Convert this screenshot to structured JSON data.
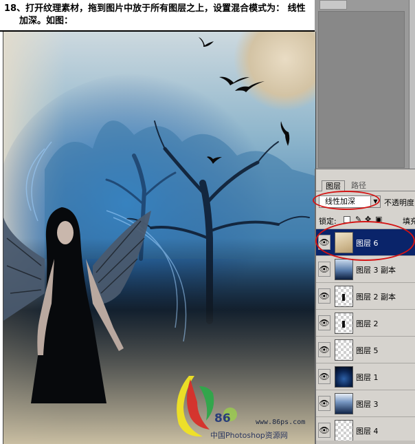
{
  "caption": {
    "line1": "18、打开纹理素材，拖到图片中放于所有图层之上，设置混合模式为： 线性",
    "line2": "加深。如图："
  },
  "palette": {
    "tabs": [
      {
        "label": "图层",
        "active": true
      },
      {
        "label": "路径",
        "active": false
      }
    ],
    "blend_mode": "线性加深",
    "opacity_label": "不透明度",
    "lock_label": "锁定:",
    "fill_label": "填充",
    "layers": [
      {
        "name": "图层 6",
        "thumb": "texture",
        "selected": true
      },
      {
        "name": "图层 3 副本",
        "thumb": "sky",
        "selected": false
      },
      {
        "name": "图层 2 副本",
        "thumb": "checker-figure",
        "selected": false
      },
      {
        "name": "图层 2",
        "thumb": "checker-figure",
        "selected": false
      },
      {
        "name": "图层 5",
        "thumb": "checker",
        "selected": false
      },
      {
        "name": "图层 1",
        "thumb": "night",
        "selected": false
      },
      {
        "name": "图层 3",
        "thumb": "dark",
        "selected": false
      },
      {
        "name": "图层 4",
        "thumb": "checker",
        "selected": false
      }
    ],
    "eye_glyph": "👁",
    "highlight_color": "#d41414",
    "selected_color": "#0a246a"
  },
  "watermark": {
    "number": "86",
    "site": "www.86ps.com",
    "cn_text": "中国Photoshop资源网"
  }
}
